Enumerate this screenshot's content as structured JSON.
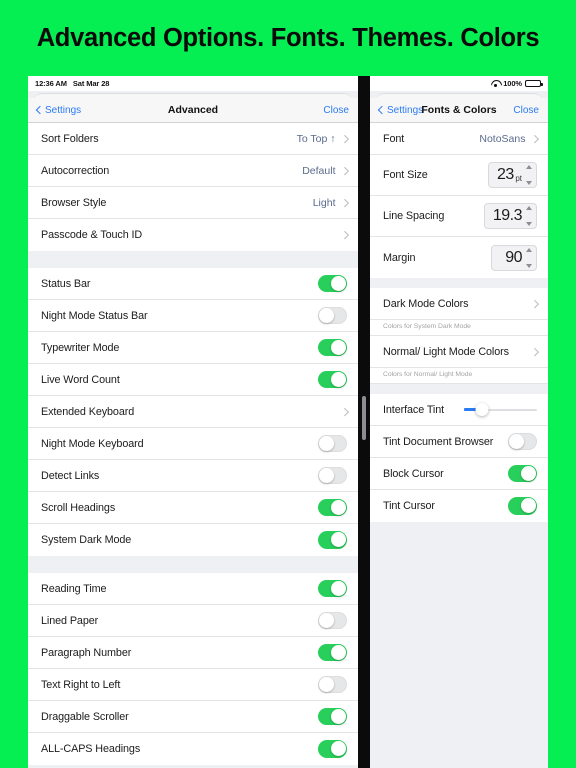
{
  "banner": {
    "title": "Advanced Options. Fonts. Themes. Colors",
    "background_color": "#05ee52",
    "text_color": "#0a0a0a"
  },
  "accent_colors": {
    "link_blue": "#2b7bf3",
    "value_blue": "#5a6b8c",
    "switch_on_green": "#29cf5b",
    "switch_off_gray": "#e6e7e9"
  },
  "left_panel": {
    "statusbar": {
      "time": "12:36 AM",
      "date": "Sat Mar 28"
    },
    "navbar": {
      "back_label": "Settings",
      "title": "Advanced",
      "close_label": "Close"
    },
    "groups": [
      {
        "rows": [
          {
            "label": "Sort Folders",
            "value": "To Top ↑",
            "type": "disclosure"
          },
          {
            "label": "Autocorrection",
            "value": "Default",
            "type": "disclosure"
          },
          {
            "label": "Browser Style",
            "value": "Light",
            "type": "disclosure"
          },
          {
            "label": "Passcode & Touch ID",
            "value": "",
            "type": "disclosure"
          }
        ]
      },
      {
        "rows": [
          {
            "label": "Status Bar",
            "type": "switch",
            "on": true
          },
          {
            "label": "Night Mode Status Bar",
            "type": "switch",
            "on": false
          },
          {
            "label": "Typewriter Mode",
            "type": "switch",
            "on": true
          },
          {
            "label": "Live Word Count",
            "type": "switch",
            "on": true
          },
          {
            "label": "Extended Keyboard",
            "value": "",
            "type": "disclosure"
          },
          {
            "label": "Night Mode Keyboard",
            "type": "switch",
            "on": false
          },
          {
            "label": "Detect Links",
            "type": "switch",
            "on": false
          },
          {
            "label": "Scroll Headings",
            "type": "switch",
            "on": true
          },
          {
            "label": "System Dark Mode",
            "type": "switch",
            "on": true
          }
        ]
      },
      {
        "rows": [
          {
            "label": "Reading Time",
            "type": "switch",
            "on": true
          },
          {
            "label": "Lined Paper",
            "type": "switch",
            "on": false
          },
          {
            "label": "Paragraph Number",
            "type": "switch",
            "on": true
          },
          {
            "label": "Text Right to Left",
            "type": "switch",
            "on": false
          },
          {
            "label": "Draggable Scroller",
            "type": "switch",
            "on": true
          },
          {
            "label": "ALL-CAPS Headings",
            "type": "switch",
            "on": true
          }
        ]
      }
    ]
  },
  "right_panel": {
    "statusbar": {
      "wifi_icon": "wifi-icon",
      "battery_percent": "100%",
      "battery_icon": "battery-icon"
    },
    "navbar": {
      "back_label": "Settings",
      "title": "Fonts & Colors",
      "close_label": "Close"
    },
    "font_group": [
      {
        "label": "Font",
        "value": "NotoSans",
        "type": "disclosure"
      },
      {
        "label": "Font Size",
        "type": "stepper",
        "value": "23",
        "unit": "pt"
      },
      {
        "label": "Line Spacing",
        "type": "stepper",
        "value": "19.3",
        "unit": ""
      },
      {
        "label": "Margin",
        "type": "stepper",
        "value": "90",
        "unit": ""
      }
    ],
    "color_group": [
      {
        "label": "Dark Mode Colors",
        "note": "Colors for System Dark Mode",
        "type": "disclosure"
      },
      {
        "label": "Normal/ Light Mode Colors",
        "note": "Colors for Normal/ Light Mode",
        "type": "disclosure"
      }
    ],
    "tint_group": [
      {
        "label": "Interface Tint",
        "type": "slider",
        "percent": 25
      },
      {
        "label": "Tint Document Browser",
        "type": "switch",
        "on": false
      },
      {
        "label": "Block Cursor",
        "type": "switch",
        "on": true
      },
      {
        "label": "Tint Cursor",
        "type": "switch",
        "on": true
      }
    ]
  }
}
